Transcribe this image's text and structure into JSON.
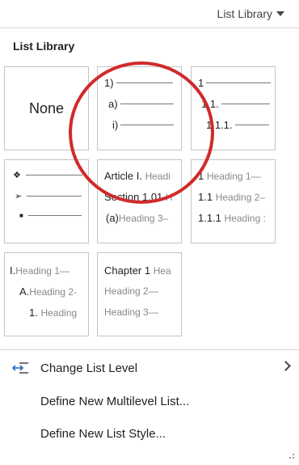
{
  "header": {
    "dropdown_label": "List Library"
  },
  "panel": {
    "title": "List Library",
    "tiles": {
      "none": {
        "label": "None"
      },
      "numbered": {
        "l1": "1)",
        "l2": "a)",
        "l3": "i)"
      },
      "outline": {
        "l1": "1",
        "l2": "1.1.",
        "l3": "1.1.1."
      },
      "bullets": {
        "l1": "❖",
        "l2": "➢",
        "l3": "■"
      },
      "article": {
        "l1_num": "Article I.",
        "l1_text": "Headi",
        "l2_num": "Section 1.01",
        "l2_text": "H",
        "l3_num": "(a)",
        "l3_text": "Heading 3–"
      },
      "heading_num": {
        "l1_num": "1",
        "l1_text": "Heading 1—",
        "l2_num": "1.1",
        "l2_text": "Heading 2–",
        "l3_num": "1.1.1",
        "l3_text": "Heading :"
      },
      "roman": {
        "l1_num": "I.",
        "l1_text": "Heading 1—",
        "l2_num": "A.",
        "l2_text": "Heading 2-",
        "l3_num": "1.",
        "l3_text": "Heading"
      },
      "chapter": {
        "l1_num": "Chapter 1",
        "l1_text": "Hea",
        "l2_text": "Heading 2—",
        "l3_text": "Heading 3—"
      }
    }
  },
  "menu": {
    "change_level": "Change List Level",
    "define_multilevel": "Define New Multilevel List...",
    "define_style": "Define New List Style..."
  },
  "colors": {
    "highlight": "#d12a2a",
    "icon_blue": "#2b6cc4"
  }
}
